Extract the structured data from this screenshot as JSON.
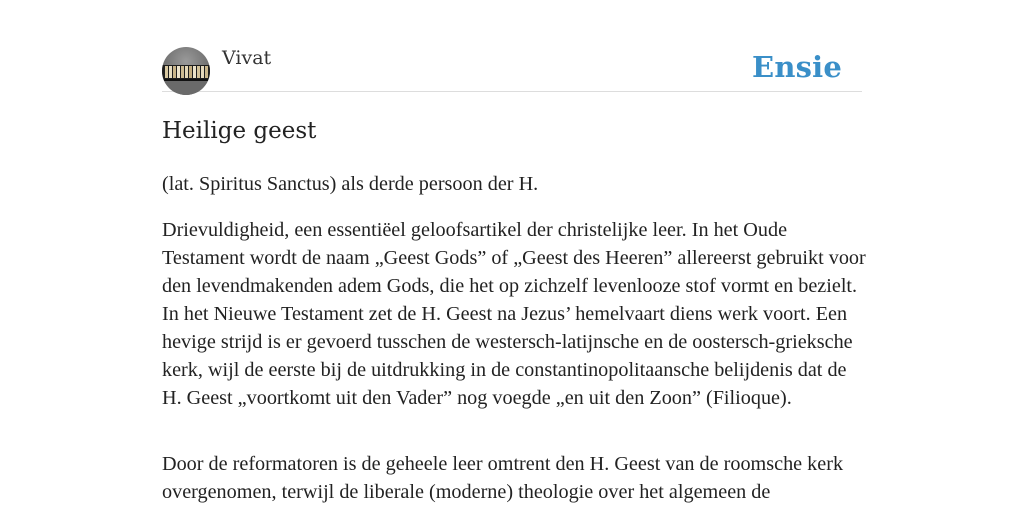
{
  "header": {
    "author": "Vivat",
    "brand": "Ensie",
    "avatar_icon": "books-avatar-icon"
  },
  "article": {
    "title": "Heilige geest",
    "paragraphs": [
      "(lat. Spiritus Sanctus) als derde persoon der H.",
      "Drievuldigheid, een essentiëel geloofsartikel der christelijke leer. In het Oude Testament wordt de naam „Geest Gods” of „Geest des Heeren” allereerst gebruikt voor den levendmakenden adem Gods, die het op zichzelf levenlooze stof vormt en bezielt. In het Nieuwe Testament zet de H. Geest na Jezus’ hemelvaart diens werk voort. Een hevige strijd is er gevoerd tusschen de westersch-latijnsche en de oostersch-grieksche kerk, wijl de eerste bij de uitdrukking in de constantinopolitaansche belijdenis dat de H. Geest „voortkomt uit den Vader” nog voegde „en uit den Zoon” (Filioque).",
      "Door de reformatoren is de geheele leer omtrent den H. Geest van de roomsche kerk overgenomen, terwijl de liberale (moderne) theologie over het algemeen de"
    ]
  },
  "colors": {
    "brand": "#3a8fc8",
    "text": "#222222",
    "divider": "#dddddd"
  }
}
